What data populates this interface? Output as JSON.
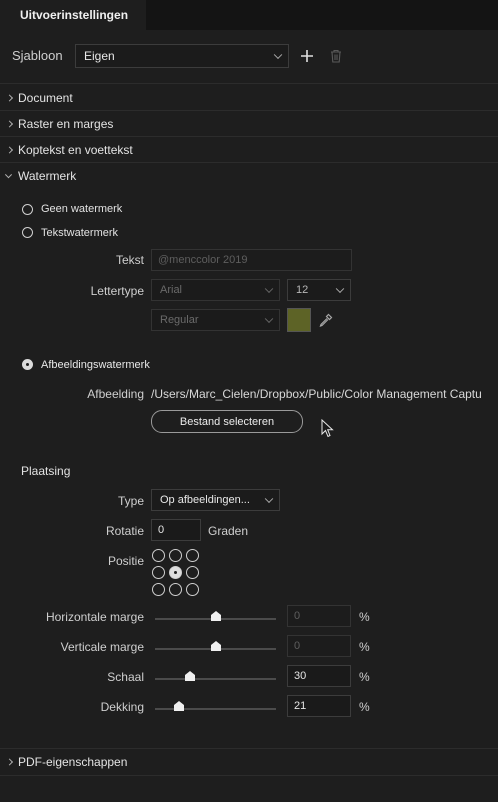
{
  "tab": {
    "title": "Uitvoerinstellingen"
  },
  "template": {
    "label": "Sjabloon",
    "value": "Eigen"
  },
  "sections": {
    "document": "Document",
    "grid": "Raster en marges",
    "header": "Koptekst en voettekst",
    "watermark": "Watermerk",
    "pdf": "PDF-eigenschappen"
  },
  "watermark": {
    "none_label": "Geen watermerk",
    "text_label": "Tekstwatermerk",
    "text_field_label": "Tekst",
    "text_placeholder": "@menccolor 2019",
    "font_label": "Lettertype",
    "font_family": "Arial",
    "font_size": "12",
    "font_style": "Regular",
    "color": "#5d6326",
    "image_label": "Afbeeldingswatermerk",
    "image_field_label": "Afbeelding",
    "image_path": "/Users/Marc_Cielen/Dropbox/Public/Color Management Captu",
    "select_file_button": "Bestand selecteren",
    "selected": "image"
  },
  "placement": {
    "title": "Plaatsing",
    "type_label": "Type",
    "type_value": "Op afbeeldingen...",
    "rotation_label": "Rotatie",
    "rotation_value": "0",
    "rotation_unit": "Graden",
    "position_label": "Positie",
    "position_selected": "center",
    "h_margin_label": "Horizontale marge",
    "h_margin_value": "0",
    "h_margin_slider": 0.5,
    "v_margin_label": "Verticale marge",
    "v_margin_value": "0",
    "v_margin_slider": 0.5,
    "scale_label": "Schaal",
    "scale_value": "30",
    "scale_slider": 0.29,
    "opacity_label": "Dekking",
    "opacity_value": "21",
    "opacity_slider": 0.2,
    "percent": "%"
  }
}
